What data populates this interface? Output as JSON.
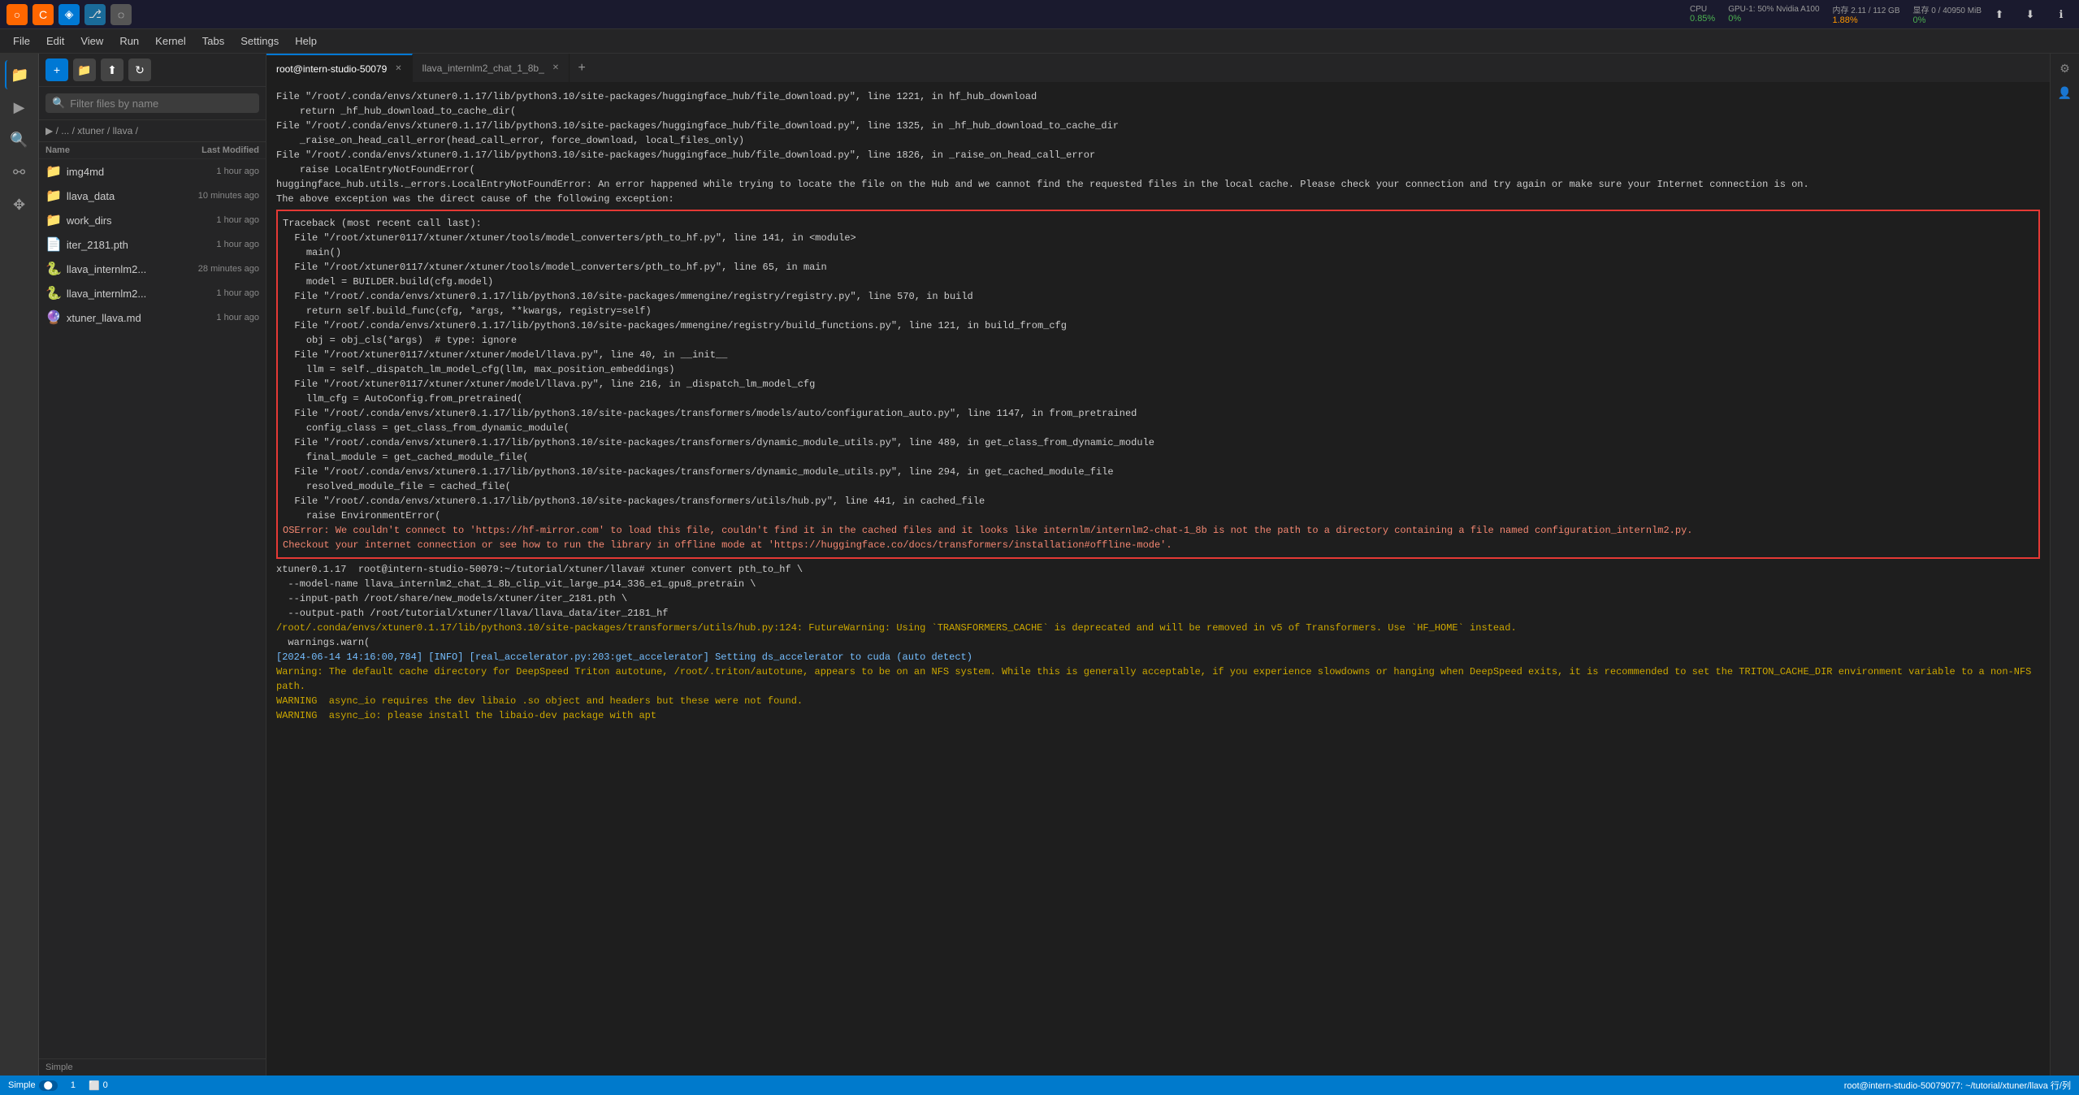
{
  "topbar": {
    "app_icons": [
      {
        "name": "jupyter-icon",
        "char": "○",
        "color": "orange"
      },
      {
        "name": "conda-icon",
        "char": "C",
        "color": "orange"
      },
      {
        "name": "vscode-icon",
        "char": "◈",
        "color": "blue"
      },
      {
        "name": "git-icon",
        "char": "⎇",
        "color": "blue"
      },
      {
        "name": "circle-icon",
        "char": "◌",
        "color": "gray"
      }
    ],
    "cpu_label": "CPU",
    "cpu_val": "0.85%",
    "gpu_label": "GPU-1: 50% Nvidia A100",
    "gpu_val": "0%",
    "mem_label": "内存 2.11 / 112 GB",
    "mem_val": "1.88%",
    "storage_label": "显存 0 / 40950 MiB",
    "storage_val": "0%"
  },
  "menubar": {
    "items": [
      "File",
      "Edit",
      "View",
      "Run",
      "Kernel",
      "Tabs",
      "Settings",
      "Help"
    ]
  },
  "sidebar_toolbar": {
    "new_file_label": "+",
    "open_folder_label": "📁",
    "upload_label": "⬆",
    "refresh_label": "↻"
  },
  "filter": {
    "placeholder": "Filter files by name"
  },
  "breadcrumb": {
    "path": "▶ / ... / xtuner / llava /"
  },
  "file_list": {
    "header": {
      "name_col": "Name",
      "modified_col": "Last Modified"
    },
    "items": [
      {
        "icon": "📁",
        "name": "img4md",
        "modified": "1 hour ago",
        "type": "folder"
      },
      {
        "icon": "📁",
        "name": "llava_data",
        "modified": "10 minutes ago",
        "type": "folder"
      },
      {
        "icon": "📁",
        "name": "work_dirs",
        "modified": "1 hour ago",
        "type": "folder"
      },
      {
        "icon": "📄",
        "name": "iter_2181.pth",
        "modified": "1 hour ago",
        "type": "file"
      },
      {
        "icon": "🐍",
        "name": "llava_internlm2...",
        "modified": "28 minutes ago",
        "type": "python"
      },
      {
        "icon": "🐍",
        "name": "llava_internlm2...",
        "modified": "1 hour ago",
        "type": "python"
      },
      {
        "icon": "🔮",
        "name": "xtuner_llava.md",
        "modified": "1 hour ago",
        "type": "markdown"
      }
    ]
  },
  "tabs": [
    {
      "label": "root@intern-studio-50079",
      "active": true,
      "closeable": true
    },
    {
      "label": "llava_internlm2_chat_1_8b_",
      "active": false,
      "closeable": true
    }
  ],
  "terminal_output": {
    "lines_before_error": [
      {
        "text": "File \"/root/.conda/envs/xtuner0.1.17/lib/python3.10/site-packages/huggingface_hub/file_download.py\", line 1221, in hf_hub_download",
        "cls": ""
      },
      {
        "text": "    return _hf_hub_download_to_cache_dir(",
        "cls": ""
      },
      {
        "text": "File \"/root/.conda/envs/xtuner0.1.17/lib/python3.10/site-packages/huggingface_hub/file_download.py\", line 1325, in _hf_hub_download_to_cache_dir",
        "cls": ""
      },
      {
        "text": "    _raise_on_head_call_error(head_call_error, force_download, local_files_only)",
        "cls": ""
      },
      {
        "text": "File \"/root/.conda/envs/xtuner0.1.17/lib/python3.10/site-packages/huggingface_hub/file_download.py\", line 1826, in _raise_on_head_call_error",
        "cls": ""
      },
      {
        "text": "    raise LocalEntryNotFoundError(",
        "cls": ""
      },
      {
        "text": "huggingface_hub.utils._errors.LocalEntryNotFoundError: An error happened while trying to locate the file on the Hub and we cannot find the requested files in the local cache. Please check your connection and try again or make sure your Internet connection is on.",
        "cls": ""
      }
    ],
    "exception_msg": "The above exception was the direct cause of the following exception:",
    "traceback_lines": [
      {
        "text": "Traceback (most recent call last):",
        "cls": ""
      },
      {
        "text": "  File \"/root/xtuner0117/xtuner/xtuner/tools/model_converters/pth_to_hf.py\", line 141, in <module>",
        "cls": ""
      },
      {
        "text": "    main()",
        "cls": ""
      },
      {
        "text": "  File \"/root/xtuner0117/xtuner/xtuner/tools/model_converters/pth_to_hf.py\", line 65, in main",
        "cls": ""
      },
      {
        "text": "    model = BUILDER.build(cfg.model)",
        "cls": ""
      },
      {
        "text": "  File \"/root/.conda/envs/xtuner0.1.17/lib/python3.10/site-packages/mmengine/registry/registry.py\", line 570, in build",
        "cls": ""
      },
      {
        "text": "    return self.build_func(cfg, *args, **kwargs, registry=self)",
        "cls": ""
      },
      {
        "text": "  File \"/root/.conda/envs/xtuner0.1.17/lib/python3.10/site-packages/mmengine/registry/build_functions.py\", line 121, in build_from_cfg",
        "cls": ""
      },
      {
        "text": "    obj = obj_cls(*args)  # type: ignore",
        "cls": ""
      },
      {
        "text": "  File \"/root/xtuner0117/xtuner/xtuner/model/llava.py\", line 40, in __init__",
        "cls": ""
      },
      {
        "text": "    llm = self._dispatch_lm_model_cfg(llm, max_position_embeddings)",
        "cls": ""
      },
      {
        "text": "  File \"/root/xtuner0117/xtuner/xtuner/model/llava.py\", line 216, in _dispatch_lm_model_cfg",
        "cls": ""
      },
      {
        "text": "    llm_cfg = AutoConfig.from_pretrained(",
        "cls": ""
      },
      {
        "text": "  File \"/root/.conda/envs/xtuner0.1.17/lib/python3.10/site-packages/transformers/models/auto/configuration_auto.py\", line 1147, in from_pretrained",
        "cls": ""
      },
      {
        "text": "    config_class = get_class_from_dynamic_module(",
        "cls": ""
      },
      {
        "text": "  File \"/root/.conda/envs/xtuner0.1.17/lib/python3.10/site-packages/transformers/dynamic_module_utils.py\", line 489, in get_class_from_dynamic_module",
        "cls": ""
      },
      {
        "text": "    final_module = get_cached_module_file(",
        "cls": ""
      },
      {
        "text": "  File \"/root/.conda/envs/xtuner0.1.17/lib/python3.10/site-packages/transformers/dynamic_module_utils.py\", line 294, in get_cached_module_file",
        "cls": ""
      },
      {
        "text": "    resolved_module_file = cached_file(",
        "cls": ""
      },
      {
        "text": "  File \"/root/.conda/envs/xtuner0.1.17/lib/python3.10/site-packages/transformers/utils/hub.py\", line 441, in cached_file",
        "cls": ""
      },
      {
        "text": "    raise EnvironmentError(",
        "cls": ""
      },
      {
        "text": "OSError: We couldn't connect to 'https://hf-mirror.com' to load this file, couldn't find it in the cached files and it looks like internlm/internlm2-chat-1_8b is not the path to a directory containing a file named configuration_internlm2.py.",
        "cls": "error"
      },
      {
        "text": "Checkout your internet connection or see how to run the library in offline mode at 'https://huggingface.co/docs/transformers/installation#offline-mode'.",
        "cls": "error"
      }
    ],
    "lines_after": [
      {
        "text": "xtuner0.1.17  root@intern-studio-50079:~/tutorial/xtuner/llava# xtuner convert pth_to_hf \\",
        "cls": ""
      },
      {
        "text": "  --model-name llava_internlm2_chat_1_8b_clip_vit_large_p14_336_e1_gpu8_pretrain \\",
        "cls": ""
      },
      {
        "text": "  --input-path /root/share/new_models/xtuner/iter_2181.pth \\",
        "cls": ""
      },
      {
        "text": "  --output-path /root/tutorial/xtuner/llava/llava_data/iter_2181_hf",
        "cls": ""
      },
      {
        "text": "/root/.conda/envs/xtuner0.1.17/lib/python3.10/site-packages/transformers/utils/hub.py:124: FutureWarning: Using `TRANSFORMERS_CACHE` is deprecated and will be removed in v5 of Transformers. Use `HF_HOME` instead.",
        "cls": "warning"
      },
      {
        "text": "  warnings.warn(",
        "cls": ""
      },
      {
        "text": "[2024-06-14 14:16:00,784] [INFO] [real_accelerator.py:203:get_accelerator] Setting ds_accelerator to cuda (auto detect)",
        "cls": "info"
      },
      {
        "text": "Warning: The default cache directory for DeepSpeed Triton autotune, /root/.triton/autotune, appears to be on an NFS system. While this is generally acceptable, if you experience slowdowns or hanging when DeepSpeed exits, it is recommended to set the TRITON_CACHE_DIR environment variable to a non-NFS path.",
        "cls": "warning"
      },
      {
        "text": "WARNING  async_io requires the dev libaio .so object and headers but these were not found.",
        "cls": "warning"
      },
      {
        "text": "WARNING  async_io: please install the libaio-dev package with apt",
        "cls": "warning"
      }
    ]
  },
  "statusbar": {
    "mode": "Simple",
    "toggle": false,
    "line_col": "1",
    "errors": "0",
    "right_text": "root@intern-studio-50079077: ~/tutorial/xtuner/llava  行/列"
  }
}
